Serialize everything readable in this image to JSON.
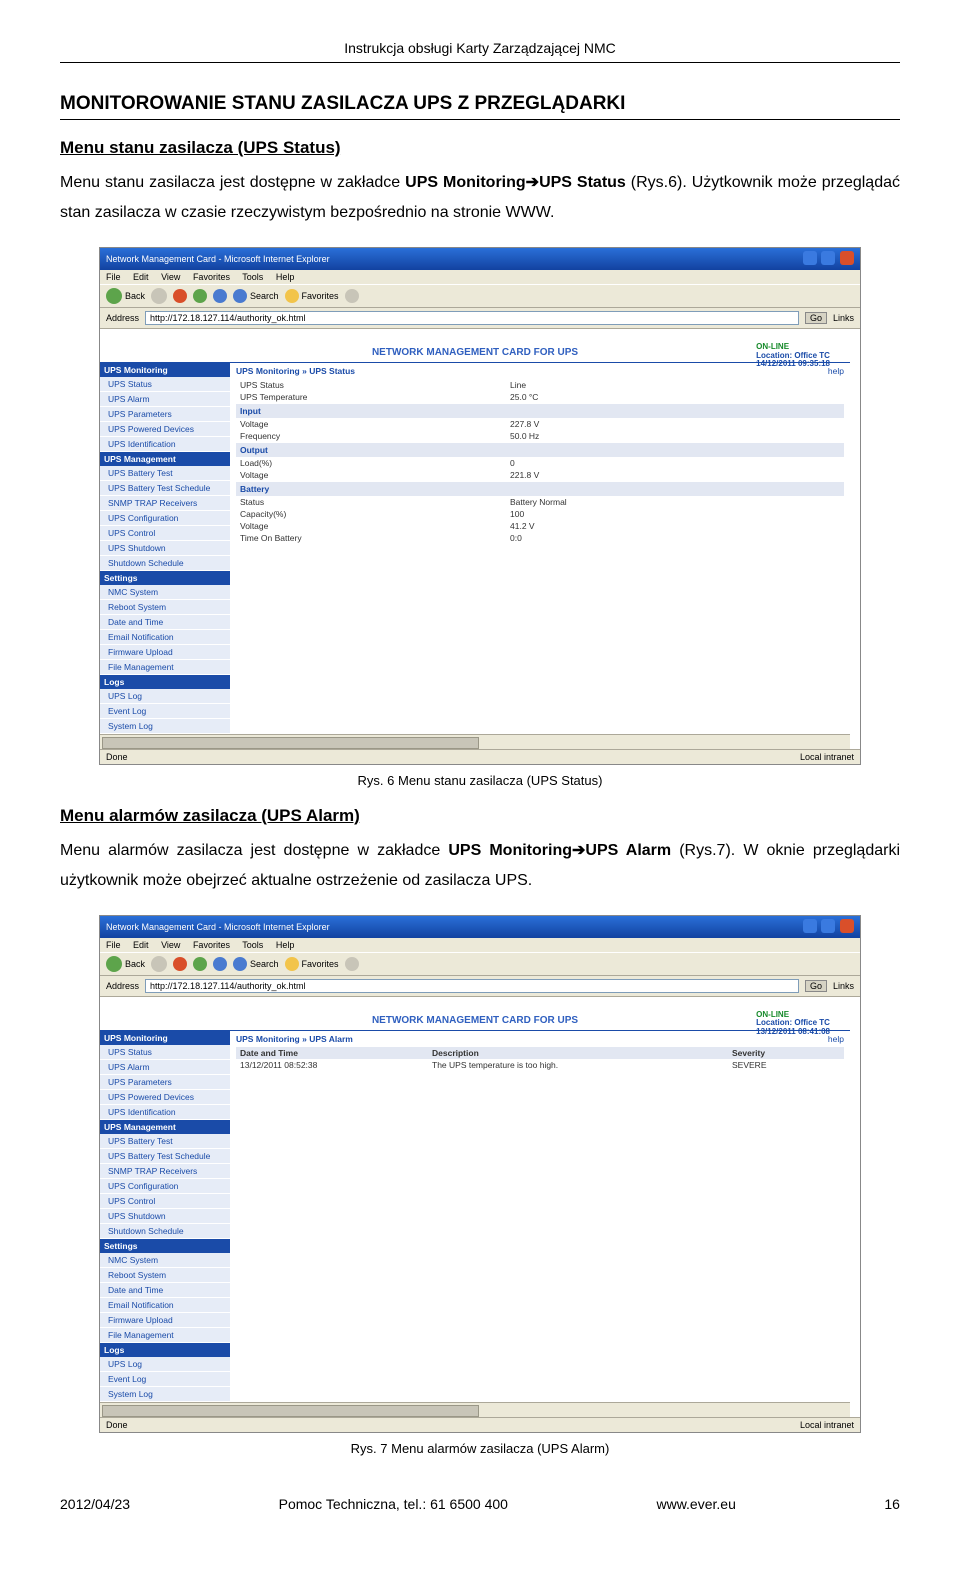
{
  "doc_header": "Instrukcja obsługi Karty Zarządzającej NMC",
  "section_title": "MONITOROWANIE STANU ZASILACZA UPS Z PRZEGLĄDARKI",
  "sub1": "Menu stanu zasilacza (UPS Status)",
  "para1_a": "Menu stanu zasilacza jest dostępne w zakładce ",
  "para1_b": "UPS Monitoring➔UPS Status",
  "para1_c": " (Rys.6). Użytkownik może przeglądać stan zasilacza w czasie rzeczywistym bezpośrednio na stronie WWW.",
  "caption1": "Rys. 6 Menu stanu zasilacza (UPS Status)",
  "sub2": "Menu alarmów zasilacza (UPS Alarm)",
  "para2_a": "Menu alarmów zasilacza jest dostępne w zakładce ",
  "para2_b": "UPS Monitoring➔UPS Alarm",
  "para2_c": " (Rys.7). W oknie przeglądarki użytkownik może obejrzeć aktualne ostrzeżenie od zasilacza UPS.",
  "caption2": "Rys. 7 Menu alarmów zasilacza (UPS Alarm)",
  "footer": {
    "date": "2012/04/23",
    "center": "Pomoc Techniczna, tel.: 61 6500 400",
    "site": "www.ever.eu",
    "page": "16"
  },
  "browser": {
    "title": "Network Management Card - Microsoft Internet Explorer",
    "menus": [
      "File",
      "Edit",
      "View",
      "Favorites",
      "Tools",
      "Help"
    ],
    "toolbar": {
      "back": "Back",
      "search": "Search",
      "favorites": "Favorites"
    },
    "address_label": "Address",
    "url": "http://172.18.127.114/authority_ok.html",
    "go": "Go",
    "links": "Links",
    "status_done": "Done",
    "status_zone": "Local intranet"
  },
  "nmc": {
    "header": "NETWORK MANAGEMENT CARD FOR UPS",
    "online": "ON-LINE",
    "location": "Location: Office TC",
    "timestamp1": "14/12/2011 09:35:18",
    "timestamp2": "13/12/2011 08:41:08",
    "help": "help",
    "sidebar_groups": [
      {
        "head": "UPS Monitoring",
        "items": [
          "UPS Status",
          "UPS Alarm",
          "UPS Parameters",
          "UPS Powered Devices",
          "UPS Identification"
        ]
      },
      {
        "head": "UPS Management",
        "items": [
          "UPS Battery Test",
          "UPS Battery Test Schedule",
          "SNMP TRAP Receivers",
          "UPS Configuration",
          "UPS Control",
          "UPS Shutdown",
          "Shutdown Schedule"
        ]
      },
      {
        "head": "Settings",
        "items": [
          "NMC System",
          "Reboot System",
          "Date and Time",
          "Email Notification",
          "Firmware Upload",
          "File Management"
        ]
      },
      {
        "head": "Logs",
        "items": [
          "UPS Log",
          "Event Log",
          "System Log"
        ]
      }
    ]
  },
  "status_panel": {
    "breadcrumb": "UPS Monitoring » UPS Status",
    "rows": [
      {
        "type": "data",
        "label": "UPS Status",
        "value": "Line"
      },
      {
        "type": "data",
        "label": "UPS Temperature",
        "value": "25.0 °C"
      },
      {
        "type": "sec",
        "label": "Input"
      },
      {
        "type": "data",
        "label": "Voltage",
        "value": "227.8 V"
      },
      {
        "type": "data",
        "label": "Frequency",
        "value": "50.0 Hz"
      },
      {
        "type": "sec",
        "label": "Output"
      },
      {
        "type": "data",
        "label": "Load(%)",
        "value": "0"
      },
      {
        "type": "data",
        "label": "Voltage",
        "value": "221.8 V"
      },
      {
        "type": "sec",
        "label": "Battery"
      },
      {
        "type": "data",
        "label": "Status",
        "value": "Battery Normal"
      },
      {
        "type": "data",
        "label": "Capacity(%)",
        "value": "100"
      },
      {
        "type": "data",
        "label": "Voltage",
        "value": "41.2 V"
      },
      {
        "type": "data",
        "label": "Time On Battery",
        "value": "0:0"
      }
    ]
  },
  "alarm_panel": {
    "breadcrumb": "UPS Monitoring » UPS Alarm",
    "head": {
      "c1": "Date and Time",
      "c2": "Description",
      "c3": "Severity"
    },
    "row": {
      "c1": "13/12/2011 08:52:38",
      "c2": "The UPS temperature is too high.",
      "c3": "SEVERE"
    }
  }
}
